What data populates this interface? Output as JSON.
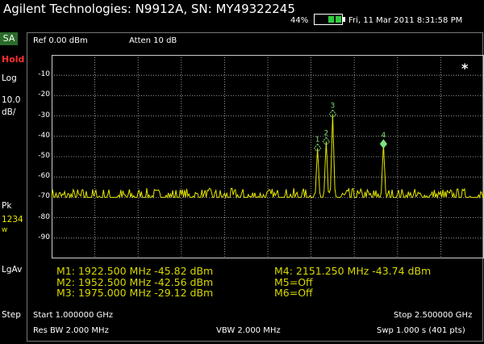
{
  "header": {
    "title": "Agilent Technologies: N9912A, SN: MY49322245",
    "battery_percent": "44%",
    "datetime": "Fri, 11 Mar 2011 8:31:58 PM"
  },
  "mode": "SA",
  "left_panel": {
    "hold": "Hold",
    "log": "Log",
    "scale_value": "10.0",
    "scale_unit": "dB/",
    "detector": "Pk",
    "traces": "1234",
    "trace_w": "w",
    "avg_type": "LgAv",
    "step": "Step"
  },
  "top_bar": {
    "ref": "Ref 0.00 dBm",
    "atten": "Atten 10 dB"
  },
  "chart_data": {
    "type": "line",
    "xlim": [
      1000,
      2500
    ],
    "ylim": [
      -100,
      0
    ],
    "y_tick_labels": [
      "-10",
      "-20",
      "-30",
      "-40",
      "-50",
      "-60",
      "-70",
      "-80",
      "-90"
    ],
    "grid": true,
    "trace_color": "#e6e600",
    "noise_floor": -70,
    "peaks": [
      {
        "x": 1922.5,
        "y": -45.82
      },
      {
        "x": 1952.5,
        "y": -42.56
      },
      {
        "x": 1975.0,
        "y": -29.12
      },
      {
        "x": 2151.25,
        "y": -43.74
      }
    ],
    "markers": [
      {
        "id": "1",
        "x": 1922.5,
        "y": -45.82
      },
      {
        "id": "2",
        "x": 1952.5,
        "y": -42.56
      },
      {
        "id": "3",
        "x": 1975.0,
        "y": -29.12
      },
      {
        "id": "4",
        "x": 2151.25,
        "y": -43.74
      }
    ],
    "star": "*"
  },
  "marker_table": {
    "m1": "M1:  1922.500 MHz   -45.82 dBm",
    "m2": "M2:  1952.500 MHz   -42.56 dBm",
    "m3": "M3:  1975.000 MHz   -29.12 dBm",
    "m4": "M4:  2151.250 MHz    -43.74 dBm",
    "m5": "M5=Off",
    "m6": "M6=Off"
  },
  "footer": {
    "start": "Start 1.000000 GHz",
    "stop": "Stop 2.500000 GHz",
    "res_bw": "Res BW 2.000 MHz",
    "vbw": "VBW 2.000 MHz",
    "sweep": "Swp 1.000  s (401 pts)"
  }
}
